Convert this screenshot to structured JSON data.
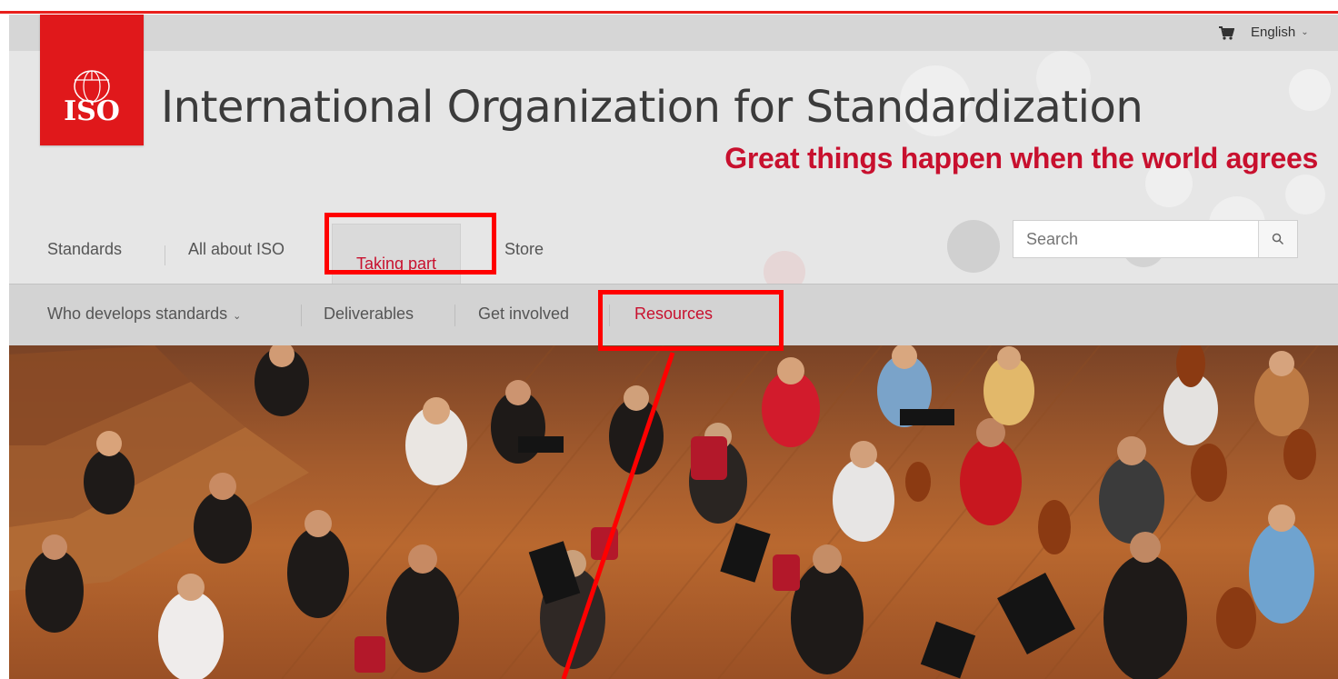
{
  "header": {
    "org_title": "International Organization for Standardization",
    "slogan": "Great things happen when the world agrees",
    "logo_text": "ISO",
    "language": "English"
  },
  "main_nav": {
    "items": [
      {
        "label": "Standards"
      },
      {
        "label": "All about ISO"
      },
      {
        "label": "Taking part",
        "active": true
      },
      {
        "label": "Store"
      }
    ]
  },
  "search": {
    "placeholder": "Search"
  },
  "sub_nav": {
    "items": [
      {
        "label": "Who develops standards"
      },
      {
        "label": "Deliverables"
      },
      {
        "label": "Get involved"
      },
      {
        "label": "Resources",
        "active": true
      }
    ]
  },
  "icons": {
    "cart": "cart-icon",
    "search": "search-icon",
    "language_chevron": "chevron-down-icon",
    "sub_nav_chevron": "chevron-down-icon"
  },
  "colors": {
    "brand_red": "#e0181b",
    "active_text": "#c8102e",
    "annotation_red": "#ff0000",
    "annotation_blue": "#1a3cf0"
  }
}
